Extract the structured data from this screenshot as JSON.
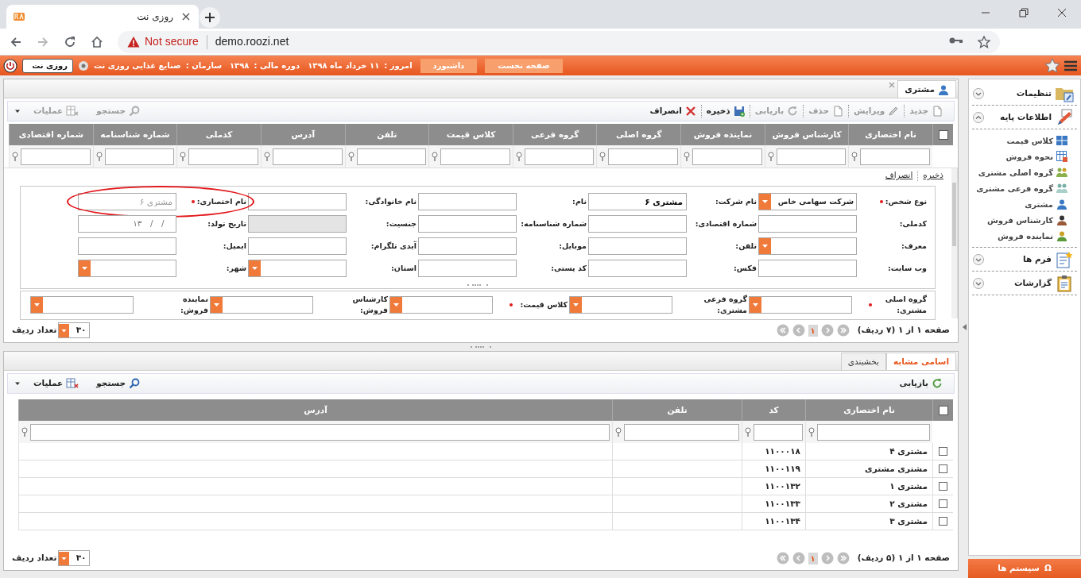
{
  "browser": {
    "tab_title": "روزی نت",
    "security": "Not secure",
    "url": "demo.roozi.net"
  },
  "header": {
    "app_button": "روزی نت",
    "nav_buttons": [
      "صفحه نخست",
      "داشبورد"
    ],
    "info": [
      {
        "label": "امروز :",
        "value": "۱۱ خرداد ماه ۱۳۹۸"
      },
      {
        "label": "دوره مالی :",
        "value": "۱۳۹۸"
      },
      {
        "label": "سازمان :",
        "value": "صنایع غذایی روزی نت"
      }
    ]
  },
  "page_tab": "مشتری",
  "toolbar": {
    "actions": [
      {
        "label": "جدید",
        "disabled": true
      },
      {
        "label": "ویرایش",
        "disabled": true
      },
      {
        "label": "حذف",
        "disabled": true
      },
      {
        "label": "بازیابی",
        "disabled": true
      },
      {
        "label": "ذخیره",
        "disabled": false
      },
      {
        "label": "انصراف",
        "disabled": false
      }
    ],
    "tools": [
      {
        "label": "جستجو",
        "disabled": true
      },
      {
        "label": "عملیات",
        "disabled": true
      }
    ]
  },
  "main_grid": {
    "select_all": false,
    "columns": [
      "نام اختصاری",
      "کارشناس فروش",
      "نماینده فروش",
      "گروه اصلی",
      "گروه فرعی",
      "کلاس قیمت",
      "تلفن",
      "آدرس",
      "کدملی",
      "شماره شناسنامه",
      "شماره اقتصادی"
    ]
  },
  "form": {
    "actions": [
      "ذخیره",
      "انصراف"
    ],
    "rows": [
      [
        {
          "label": "نوع شخص:",
          "required": true,
          "highlighted": false,
          "kind": "select",
          "value": "شرکت سهامی خاص"
        },
        {
          "label": "نام شرکت:",
          "required": false,
          "highlighted": false,
          "kind": "text",
          "value": "مشتری ۶"
        },
        {
          "label": "نام:",
          "required": false,
          "highlighted": false,
          "kind": "text"
        },
        {
          "label": "نام خانوادگی:",
          "required": false,
          "highlighted": false,
          "kind": "text"
        },
        {
          "label": "نام اختصاری:",
          "required": true,
          "highlighted": true,
          "kind": "text",
          "placeholder": "مشتری ۶"
        }
      ],
      [
        {
          "label": "کدملی:",
          "required": false,
          "highlighted": false,
          "kind": "text"
        },
        {
          "label": "شماره اقتصادی:",
          "required": false,
          "highlighted": false,
          "kind": "text"
        },
        {
          "label": "شماره شناسنامه:",
          "required": false,
          "highlighted": false,
          "kind": "text"
        },
        {
          "label": "جنسیت:",
          "required": false,
          "highlighted": false,
          "kind": "readonly"
        },
        {
          "label": "تاریخ تولد:",
          "required": false,
          "highlighted": false,
          "kind": "date",
          "placeholder": "۱۳__/__/__"
        }
      ],
      [
        {
          "label": "معرف:",
          "required": false,
          "highlighted": false,
          "kind": "select"
        },
        {
          "label": "تلفن:",
          "required": false,
          "highlighted": false,
          "kind": "text"
        },
        {
          "label": "موبایل:",
          "required": false,
          "highlighted": false,
          "kind": "text"
        },
        {
          "label": "آیدی تلگرام:",
          "required": false,
          "highlighted": false,
          "kind": "text"
        },
        {
          "label": "ایمیل:",
          "required": false,
          "highlighted": false,
          "kind": "text"
        }
      ],
      [
        {
          "label": "وب سایت:",
          "required": false,
          "highlighted": false,
          "kind": "text"
        },
        {
          "label": "فکس:",
          "required": false,
          "highlighted": false,
          "kind": "text"
        },
        {
          "label": "کد پستی:",
          "required": false,
          "highlighted": false,
          "kind": "text"
        },
        {
          "label": "استان:",
          "required": false,
          "highlighted": false,
          "kind": "select"
        },
        {
          "label": "شهر:",
          "required": false,
          "highlighted": false,
          "kind": "select"
        }
      ]
    ],
    "groups": [
      {
        "label": "گروه اصلی مشتری:",
        "required": true,
        "highlighted": false,
        "kind": "select"
      },
      {
        "label": "گروه فرعی مشتری:",
        "required": false,
        "highlighted": false,
        "kind": "select"
      },
      {
        "label": "کلاس قیمت:",
        "required": true,
        "highlighted": false,
        "kind": "select"
      },
      {
        "label": "کارشناس فروش:",
        "required": false,
        "highlighted": false,
        "kind": "select"
      },
      {
        "label": "نماینده فروش:",
        "required": false,
        "highlighted": false,
        "kind": "select"
      }
    ]
  },
  "pager": {
    "summary": "صفحه ۱ از ۱ (۷ ردیف)",
    "page": "۱",
    "rows_value": "۳۰",
    "rows_label": "تعداد ردیف"
  },
  "bottom": {
    "tabs": [
      {
        "label": "اسامی مشابه",
        "selected": true
      },
      {
        "label": "بخشبندی",
        "selected": false
      }
    ],
    "toolbar": {
      "actions": [
        {
          "label": "بازیابی",
          "disabled": false
        }
      ],
      "tools": [
        {
          "label": "جستجو",
          "disabled": false
        },
        {
          "label": "عملیات",
          "disabled": false
        }
      ]
    },
    "grid": {
      "select_all": false,
      "columns": [
        "نام اختصاری",
        "کد",
        "تلفن",
        "آدرس"
      ],
      "rows": [
        {
          "checked": false,
          "cells": [
            "مشتری ۴",
            "۱۱۰۰۰۱۸"
          ]
        },
        {
          "checked": false,
          "cells": [
            "مشتری مشتری",
            "۱۱۰۰۱۱۹"
          ]
        },
        {
          "checked": false,
          "cells": [
            "مشتری ۱",
            "۱۱۰۰۱۳۲"
          ]
        },
        {
          "checked": false,
          "cells": [
            "مشتری ۲",
            "۱۱۰۰۱۳۳"
          ]
        },
        {
          "checked": false,
          "cells": [
            "مشتری ۳",
            "۱۱۰۰۱۳۴"
          ]
        }
      ]
    },
    "pager": {
      "summary": "صفحه ۱ از ۱ (۵ ردیف)",
      "page": "۱",
      "rows_value": "۳۰",
      "rows_label": "تعداد ردیف"
    }
  },
  "sidebar": {
    "sections": [
      {
        "title": "تنظیمات",
        "expanded": false
      },
      {
        "title": "اطلاعات پایه",
        "expanded": true,
        "items": [
          "کلاس قیمت",
          "نحوه فروش",
          "گروه اصلی مشتری",
          "گروه فرعی مشتری",
          "مشتری",
          "کارشناس فروش",
          "نماینده فروش"
        ]
      },
      {
        "title": "فرم ها",
        "expanded": false
      },
      {
        "title": "گزارشات",
        "expanded": false
      }
    ],
    "footer": {
      "icon": "Ω",
      "label": "سیستم ها"
    }
  }
}
